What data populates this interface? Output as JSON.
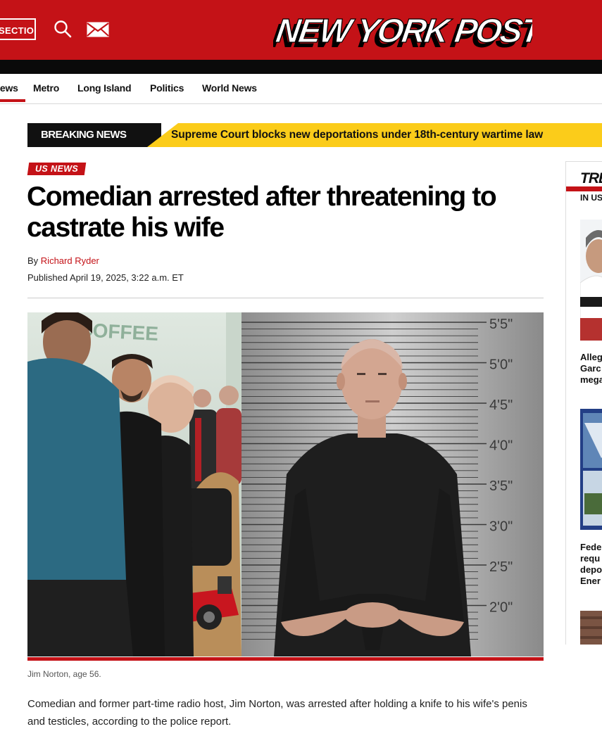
{
  "header": {
    "sections_label": "SECTIONS",
    "logo_text": "NEW YORK POST",
    "colors": {
      "brand_red": "#c41217",
      "breaking_yellow": "#fbcc1a"
    }
  },
  "nav": {
    "items": [
      "News",
      "Metro",
      "Long Island",
      "Politics",
      "World News"
    ],
    "active": "News"
  },
  "breaking": {
    "label": "BREAKING NEWS",
    "headline": "Supreme Court blocks new deportations under 18th-century wartime law"
  },
  "article": {
    "tag": "US NEWS",
    "headline": "Comedian arrested after threatening to castrate his wife",
    "byline_prefix": "By",
    "author": "Richard Ryder",
    "published": "Published April 19, 2025, 3:22 a.m. ET",
    "caption": "Jim Norton, age 56.",
    "body": "Comedian and former part-time radio host, Jim Norton, was arrested after holding a knife to his wife's penis and testicles, according to the police report.",
    "photo_text": {
      "coffee_sign": "COFFEE",
      "height_marks": [
        "5'5\"",
        "5'0\"",
        "4'5\"",
        "4'0\"",
        "3'5\"",
        "3'0\"",
        "2'5\"",
        "2'0\""
      ]
    }
  },
  "sidebar": {
    "title": "TRENDING",
    "subtitle": "IN US NEWS",
    "items": [
      {
        "lines": [
          "Alleg",
          "Garc",
          "mega"
        ]
      },
      {
        "lines": [
          "Fede",
          "requ",
          "depo",
          "Ener"
        ]
      }
    ]
  }
}
